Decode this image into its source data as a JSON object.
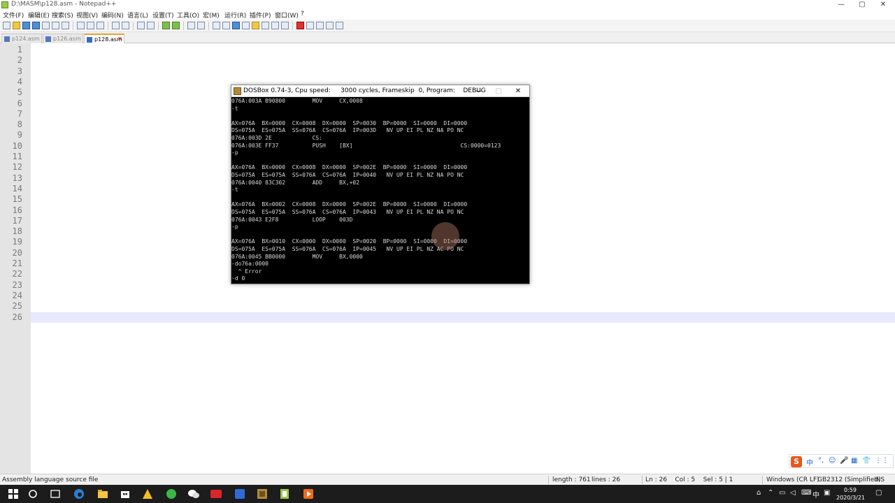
{
  "window": {
    "title": "D:\\MASM\\p128.asm - Notepad++"
  },
  "menu": [
    "文件(F)",
    "编辑(E)",
    "搜索(S)",
    "视图(V)",
    "编码(N)",
    "语言(L)",
    "设置(T)",
    "工具(O)",
    "宏(M)",
    "运行(R)",
    "插件(P)",
    "窗口(W)",
    "?"
  ],
  "tabs": [
    {
      "label": "p124.asm",
      "active": false
    },
    {
      "label": "p126.asm",
      "active": false
    },
    {
      "label": "p128.asm",
      "active": true
    }
  ],
  "editor": {
    "line_numbers": [
      "1",
      "2",
      "3",
      "4",
      "5",
      "6",
      "7",
      "8",
      "9",
      "10",
      "11",
      "12",
      "13",
      "14",
      "15",
      "16",
      "17",
      "18",
      "19",
      "20",
      "21",
      "22",
      "23",
      "24",
      "25",
      "26"
    ],
    "current_line": 26
  },
  "dosbox": {
    "title": "DOSBox 0.74-3, Cpu speed:     3000 cycles, Frameskip  0, Program:    DEBUG",
    "lines": [
      "076A:003A B90800        MOV     CX,0008",
      "-t",
      "",
      "AX=076A  BX=0000  CX=0008  DX=0000  SP=0030  BP=0000  SI=0000  DI=0000",
      "DS=075A  ES=075A  SS=076A  CS=076A  IP=003D   NV UP EI PL NZ NA PO NC",
      "076A:003D 2E            CS:",
      "076A:003E FF37          PUSH    [BX]                                CS:0000=0123",
      "-p",
      "",
      "AX=076A  BX=0000  CX=0008  DX=0000  SP=002E  BP=0000  SI=0000  DI=0000",
      "DS=075A  ES=075A  SS=076A  CS=076A  IP=0040   NV UP EI PL NZ NA PO NC",
      "076A:0040 83C302        ADD     BX,+02",
      "-t",
      "",
      "AX=076A  BX=0002  CX=0008  DX=0000  SP=002E  BP=0000  SI=0000  DI=0000",
      "DS=075A  ES=075A  SS=076A  CS=076A  IP=0043   NV UP EI PL NZ NA PO NC",
      "076A:0043 E2F8          LOOP    003D",
      "-p",
      "",
      "AX=076A  BX=0010  CX=0000  DX=0000  SP=0020  BP=0000  SI=0000  DI=0000",
      "DS=075A  ES=075A  SS=076A  CS=076A  IP=0045   NV UP EI PL NZ AC PO NC",
      "076A:0045 BB0000        MOV     BX,0000",
      "-do76a:0000",
      "  ^ Error",
      "-d 0"
    ]
  },
  "ime": {
    "logo": "S",
    "items": [
      "中",
      "°,",
      "☺",
      "🎤",
      "▦",
      "👕",
      "⋮⋮"
    ]
  },
  "status": {
    "file_type": "Assembly language source file",
    "length": "length : 761",
    "lines": "lines : 26",
    "position": "Ln : 26    Col : 5    Sel : 5 | 1",
    "eol": "Windows (CR LF)",
    "encoding": "GB2312 (Simplified)",
    "mode": "INS"
  },
  "taskbar": {
    "tray_lang": "中",
    "time": "0:59",
    "date": "2020/3/21"
  },
  "colors": {
    "keyword": "#0000ff",
    "instruction": "#0000c8",
    "number": "#ff8000",
    "register": "#8080ff",
    "comment": "#008000",
    "label_highlight": "#7fe07f",
    "current_line": "#e8e8ff"
  }
}
